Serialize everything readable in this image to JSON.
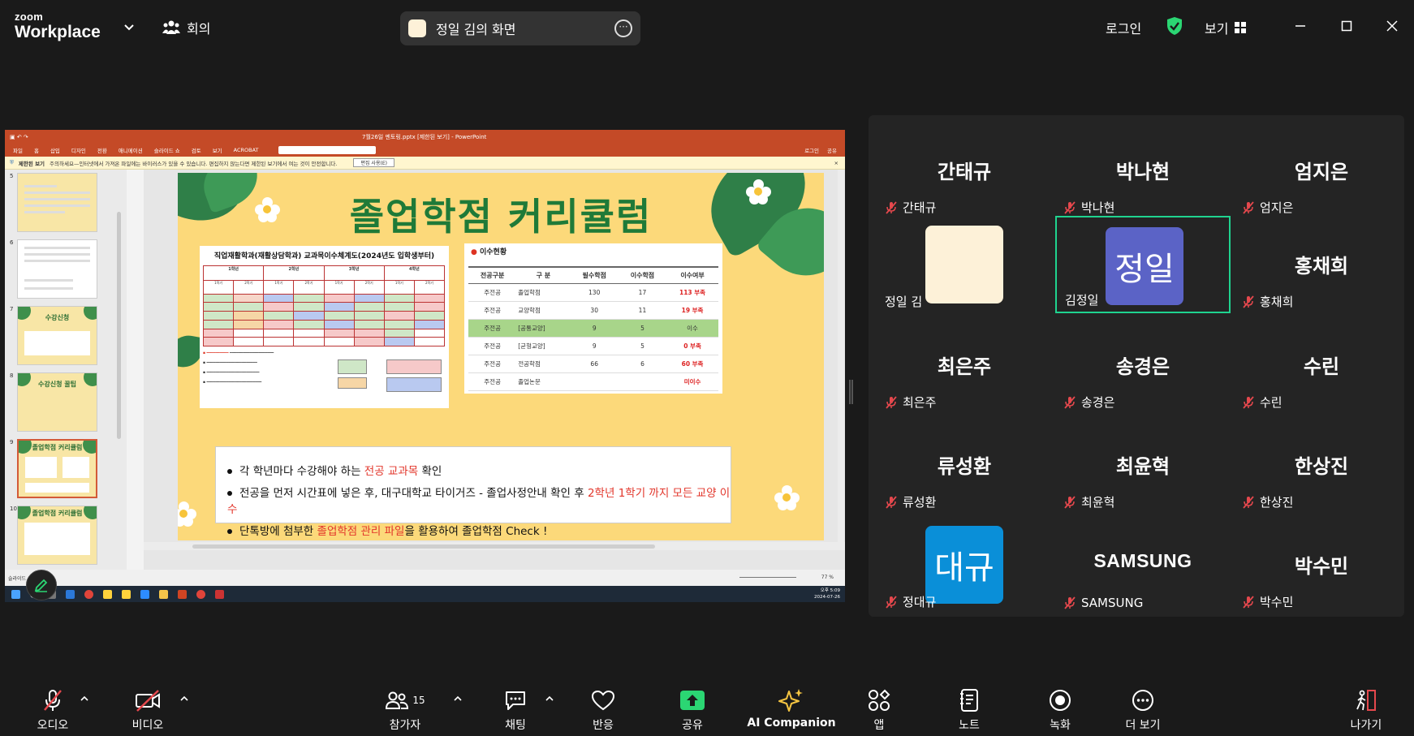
{
  "app": {
    "brand_small": "zoom",
    "brand_big": "Workplace"
  },
  "topbar": {
    "meeting_label": "회의",
    "share_label": "정일 김의 화면",
    "login_label": "로그인",
    "view_label": "보기"
  },
  "ppt": {
    "title": "7월26일 멘토링.pptx [제한된 보기] - PowerPoint",
    "ribbon_tabs": [
      "파일",
      "홈",
      "삽입",
      "디자인",
      "전환",
      "애니메이션",
      "슬라이드 쇼",
      "검토",
      "보기",
      "ACROBAT"
    ],
    "ribbon_right": [
      "로그인",
      "공유"
    ],
    "warn_label": "제한된 보기",
    "warn_text": "주의하세요—인터넷에서 가져온 파일에는 바이러스가 있을 수 있습니다. 편집하지 않는다면 제한된 보기에서 여는 것이 안전합니다.",
    "warn_button": "편집 사용(E)",
    "thumbnails": [
      {
        "num": "5",
        "title": ""
      },
      {
        "num": "6",
        "title": ""
      },
      {
        "num": "7",
        "title": "수강신청"
      },
      {
        "num": "8",
        "title": "수강신청 꿀팁"
      },
      {
        "num": "9",
        "title": "졸업학점 커리큘럼"
      },
      {
        "num": "10",
        "title": "졸업학점 커리큘럼"
      }
    ],
    "status_left": "슬라이드",
    "zoom": "77 %",
    "clock_time": "오후 5:09",
    "clock_date": "2024-07-26"
  },
  "slide": {
    "title": "졸업학점 커리큘럼",
    "table1_caption": "직업재활학과(재활상담학과) 교과목이수체계도(2024년도 입학생부터)",
    "table1_years": [
      "1학년",
      "2학년",
      "3학년",
      "4학년"
    ],
    "table1_terms": [
      "1학기",
      "2학기",
      "1학기",
      "2학기",
      "1학기",
      "2학기",
      "1학기",
      "2학기"
    ],
    "table2_caption": "이수현황",
    "table2_headers": [
      "전공구분",
      "구 분",
      "필수학점",
      "이수학점",
      "이수여부"
    ],
    "table2_rows": [
      [
        "주전공",
        "졸업학점",
        "130",
        "17",
        "113 부족"
      ],
      [
        "주전공",
        "교양학점",
        "30",
        "11",
        "19 부족"
      ],
      [
        "주전공",
        "[공통교양]",
        "9",
        "5",
        "이수"
      ],
      [
        "주전공",
        "[균형교양]",
        "9",
        "5",
        "0 부족"
      ],
      [
        "주전공",
        "전공학점",
        "66",
        "6",
        "60 부족"
      ],
      [
        "주전공",
        "졸업논문",
        "",
        "",
        "미이수"
      ]
    ],
    "bullets": [
      {
        "a": "각 학년마다 수강해야 하는 ",
        "r": "전공 교과목",
        "b": " 확인"
      },
      {
        "a": "전공을 먼저 시간표에 넣은 후, 대구대학교 타이거즈 - 졸업사정안내 확인 후 ",
        "r": "2학년 1학기 까지 모든 교양 이수",
        "b": ""
      },
      {
        "a": "단톡방에 첨부한 ",
        "r": "졸업학점 관리 파일",
        "b": "을 활용하여 졸업학점 Check !"
      }
    ]
  },
  "participants": [
    {
      "big": "간태규",
      "name": "간태규",
      "muted": true
    },
    {
      "big": "박나현",
      "name": "박나현",
      "muted": true
    },
    {
      "big": "엄지은",
      "name": "엄지은",
      "muted": true
    },
    {
      "big": "",
      "name": "정일 김",
      "muted": false,
      "avatar_color": "#fdf1d8"
    },
    {
      "big": "정일",
      "name": "김정일",
      "muted": false,
      "avatar_color": "#5b63c6",
      "active": true
    },
    {
      "big": "홍채희",
      "name": "홍채희",
      "muted": true
    },
    {
      "big": "최은주",
      "name": "최은주",
      "muted": true
    },
    {
      "big": "송경은",
      "name": "송경은",
      "muted": true
    },
    {
      "big": "수린",
      "name": "수린",
      "muted": true
    },
    {
      "big": "류성환",
      "name": "류성환",
      "muted": true
    },
    {
      "big": "최윤혁",
      "name": "최윤혁",
      "muted": true
    },
    {
      "big": "한상진",
      "name": "한상진",
      "muted": true
    },
    {
      "big": "대규",
      "name": "정대규",
      "muted": true,
      "avatar_color": "#0a8fd8"
    },
    {
      "big": "SAMSUNG",
      "name": "SAMSUNG",
      "muted": true
    },
    {
      "big": "박수민",
      "name": "박수민",
      "muted": true
    }
  ],
  "toolbar": {
    "audio": "오디오",
    "video": "비디오",
    "participants": "참가자",
    "participants_count": "15",
    "chat": "채팅",
    "reactions": "반응",
    "share": "공유",
    "ai": "AI Companion",
    "apps": "앱",
    "notes": "노트",
    "record": "녹화",
    "more": "더 보기",
    "leave": "나가기"
  },
  "colors": {
    "accent_green": "#1fd38f",
    "share_green": "#2bd673",
    "muted_red": "#e5484d",
    "ppt_red": "#c44a27"
  }
}
